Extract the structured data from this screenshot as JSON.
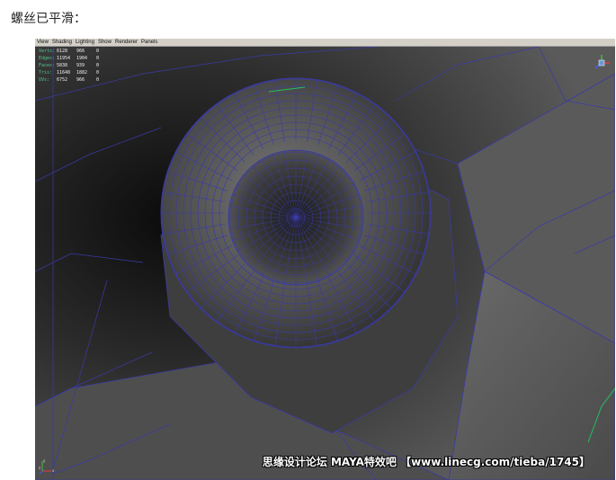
{
  "caption": "螺丝已平滑：",
  "viewport": {
    "menu": [
      "View",
      "Shading",
      "Lighting",
      "Show",
      "Renderer",
      "Panels"
    ],
    "hud": [
      {
        "label": "Verts:",
        "v1": "6128",
        "v2": "966",
        "v3": "0"
      },
      {
        "label": "Edges:",
        "v1": "11954",
        "v2": "1904",
        "v3": "0"
      },
      {
        "label": "Faces:",
        "v1": "5838",
        "v2": "939",
        "v3": "0"
      },
      {
        "label": "Tris:",
        "v1": "11648",
        "v2": "1882",
        "v3": "0"
      },
      {
        "label": "UVs:",
        "v1": "6752",
        "v2": "966",
        "v3": "0"
      }
    ],
    "axis": {
      "x": "x",
      "y": "y",
      "z": "z"
    },
    "watermark": "思缘设计论坛 MAYA特效吧 【www.linecg.com/tieba/1745】",
    "colors": {
      "wire": "#3a3aa8",
      "accent_green": "#22c060",
      "hud_label": "#4fc98a"
    }
  }
}
